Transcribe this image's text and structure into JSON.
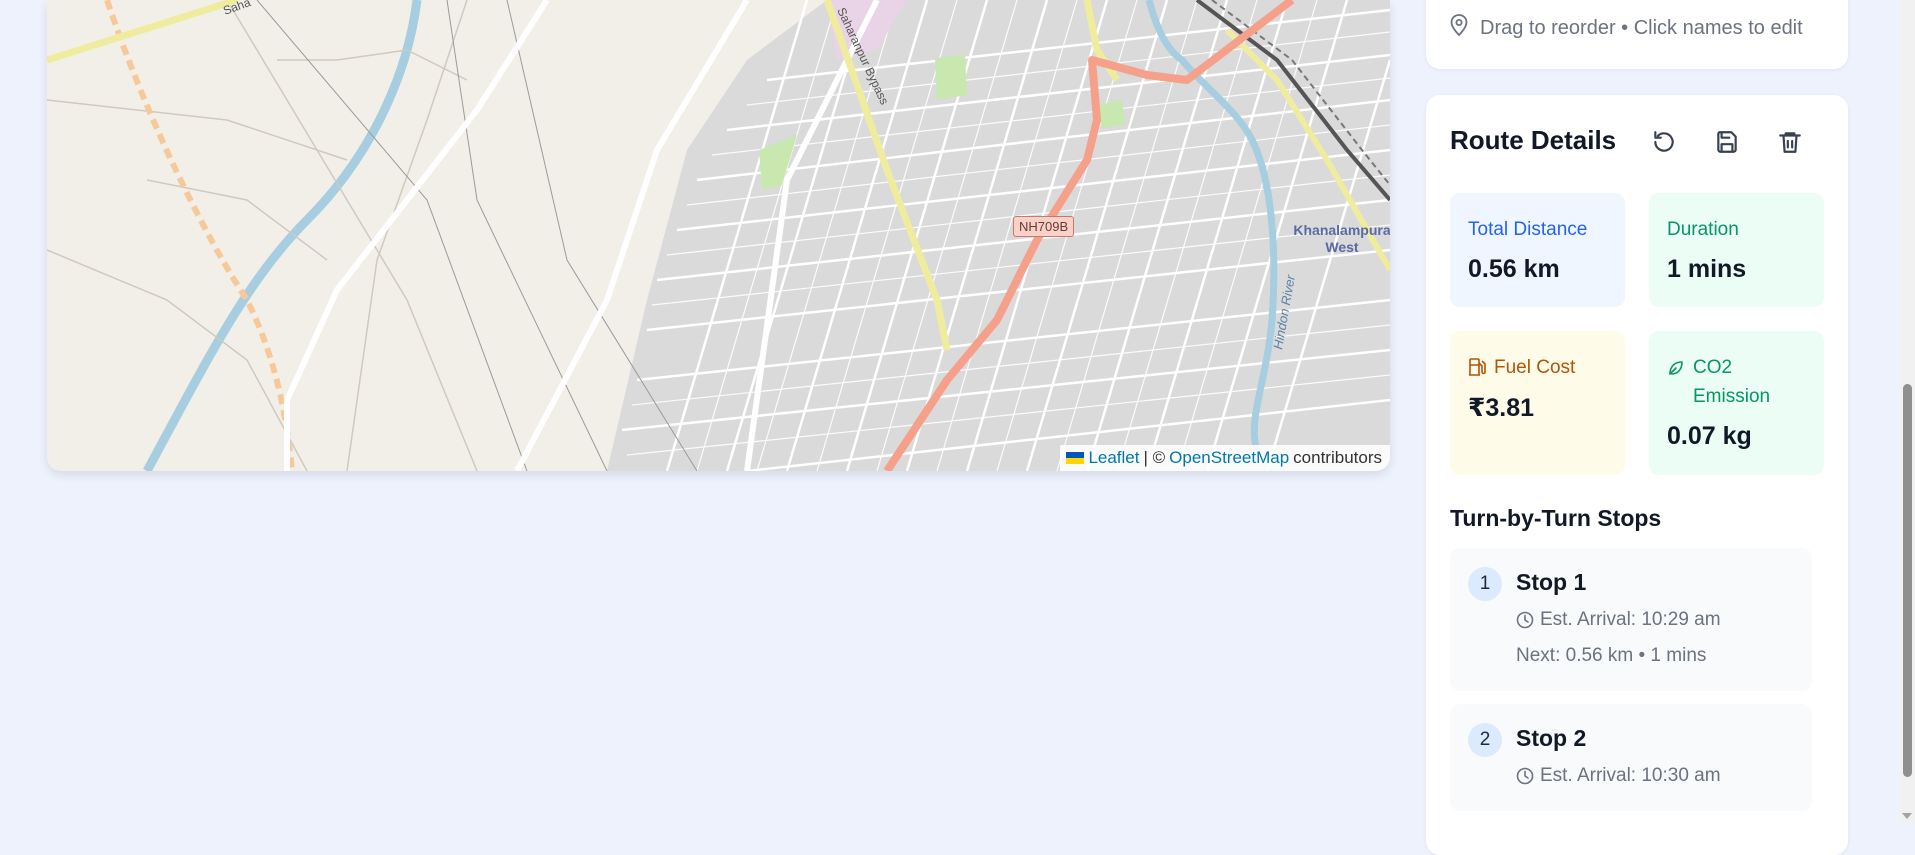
{
  "map": {
    "road_shield": "NH709B",
    "place_label": "Khanalampura West",
    "river_label": "Hindon River",
    "bypass_label": "Saharanpur Bypass",
    "road_label_topleft": "Saha",
    "attribution": {
      "leaflet": "Leaflet",
      "separator": "| ©",
      "osm": "OpenStreetMap",
      "contributors": "contributors"
    },
    "route_color": "#f5a08a"
  },
  "panel": {
    "hint": "Drag to reorder • Click names to edit",
    "title": "Route Details",
    "actions": [
      "reset",
      "save",
      "delete"
    ],
    "stats": {
      "distance": {
        "label": "Total Distance",
        "value": "0.56 km"
      },
      "duration": {
        "label": "Duration",
        "value": "1 mins"
      },
      "fuel": {
        "label": "Fuel Cost",
        "value": "₹3.81"
      },
      "co2": {
        "label": "CO2 Emission",
        "value": "0.07 kg"
      }
    },
    "stops_title": "Turn-by-Turn Stops",
    "stops": [
      {
        "num": "1",
        "name": "Stop 1",
        "eta": "Est. Arrival: 10:29 am",
        "next": "Next: 0.56 km • 1 mins"
      },
      {
        "num": "2",
        "name": "Stop 2",
        "eta": "Est. Arrival: 10:30 am"
      }
    ]
  },
  "colors": {
    "background": "#eef2fd",
    "accent_blue": "#2563eb",
    "accent_green": "#059669",
    "accent_amber": "#b45309"
  }
}
